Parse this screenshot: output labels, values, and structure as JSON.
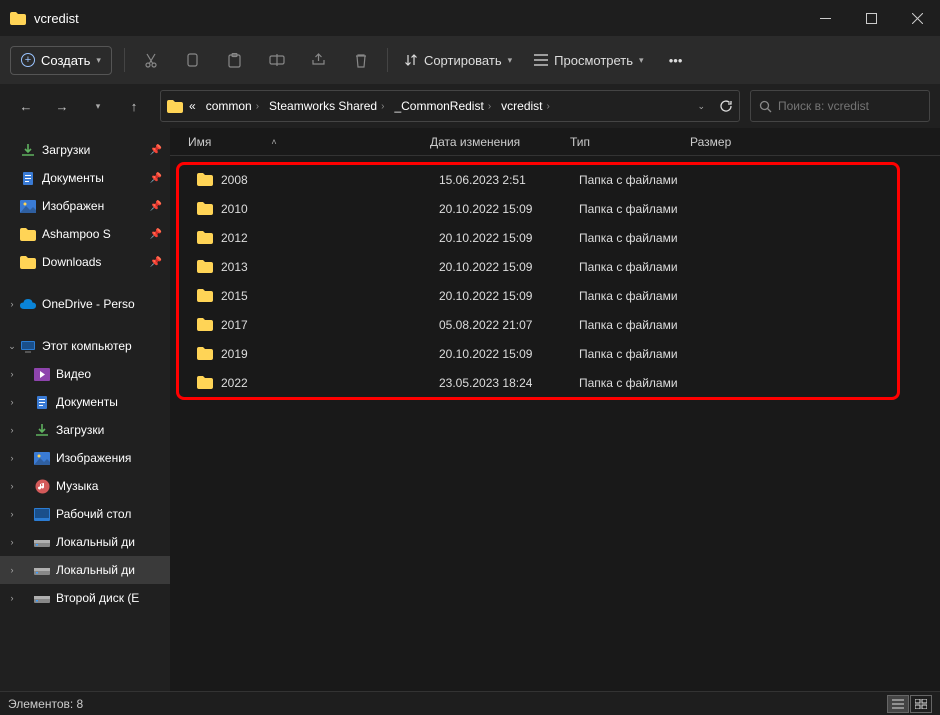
{
  "window": {
    "title": "vcredist"
  },
  "toolbar": {
    "create_label": "Создать",
    "sort_label": "Сортировать",
    "view_label": "Просмотреть"
  },
  "breadcrumb": {
    "prefix": "«",
    "items": [
      "common",
      "Steamworks Shared",
      "_CommonRedist",
      "vcredist"
    ]
  },
  "search": {
    "placeholder": "Поиск в: vcredist"
  },
  "columns": {
    "name": "Имя",
    "date": "Дата изменения",
    "type": "Тип",
    "size": "Размер"
  },
  "sidebar": {
    "quick": [
      {
        "label": "Загрузки",
        "icon": "download",
        "pinned": true
      },
      {
        "label": "Документы",
        "icon": "doc",
        "pinned": true
      },
      {
        "label": "Изображен",
        "icon": "image",
        "pinned": true
      },
      {
        "label": "Ashampoo S",
        "icon": "folder",
        "pinned": true
      },
      {
        "label": "Downloads",
        "icon": "folder",
        "pinned": true
      }
    ],
    "onedrive": {
      "label": "OneDrive - Perso",
      "icon": "cloud"
    },
    "thispc": {
      "label": "Этот компьютер",
      "children": [
        {
          "label": "Видео",
          "icon": "video"
        },
        {
          "label": "Документы",
          "icon": "doc"
        },
        {
          "label": "Загрузки",
          "icon": "download"
        },
        {
          "label": "Изображения",
          "icon": "image"
        },
        {
          "label": "Музыка",
          "icon": "music"
        },
        {
          "label": "Рабочий стол",
          "icon": "desktop"
        },
        {
          "label": "Локальный ди",
          "icon": "drive"
        },
        {
          "label": "Локальный ди",
          "icon": "drive",
          "active": true
        },
        {
          "label": "Второй диск (E",
          "icon": "drive"
        }
      ]
    }
  },
  "files": [
    {
      "name": "2008",
      "date": "15.06.2023 2:51",
      "type": "Папка с файлами"
    },
    {
      "name": "2010",
      "date": "20.10.2022 15:09",
      "type": "Папка с файлами"
    },
    {
      "name": "2012",
      "date": "20.10.2022 15:09",
      "type": "Папка с файлами"
    },
    {
      "name": "2013",
      "date": "20.10.2022 15:09",
      "type": "Папка с файлами"
    },
    {
      "name": "2015",
      "date": "20.10.2022 15:09",
      "type": "Папка с файлами"
    },
    {
      "name": "2017",
      "date": "05.08.2022 21:07",
      "type": "Папка с файлами"
    },
    {
      "name": "2019",
      "date": "20.10.2022 15:09",
      "type": "Папка с файлами"
    },
    {
      "name": "2022",
      "date": "23.05.2023 18:24",
      "type": "Папка с файлами"
    }
  ],
  "status": {
    "count_label": "Элементов: 8"
  }
}
